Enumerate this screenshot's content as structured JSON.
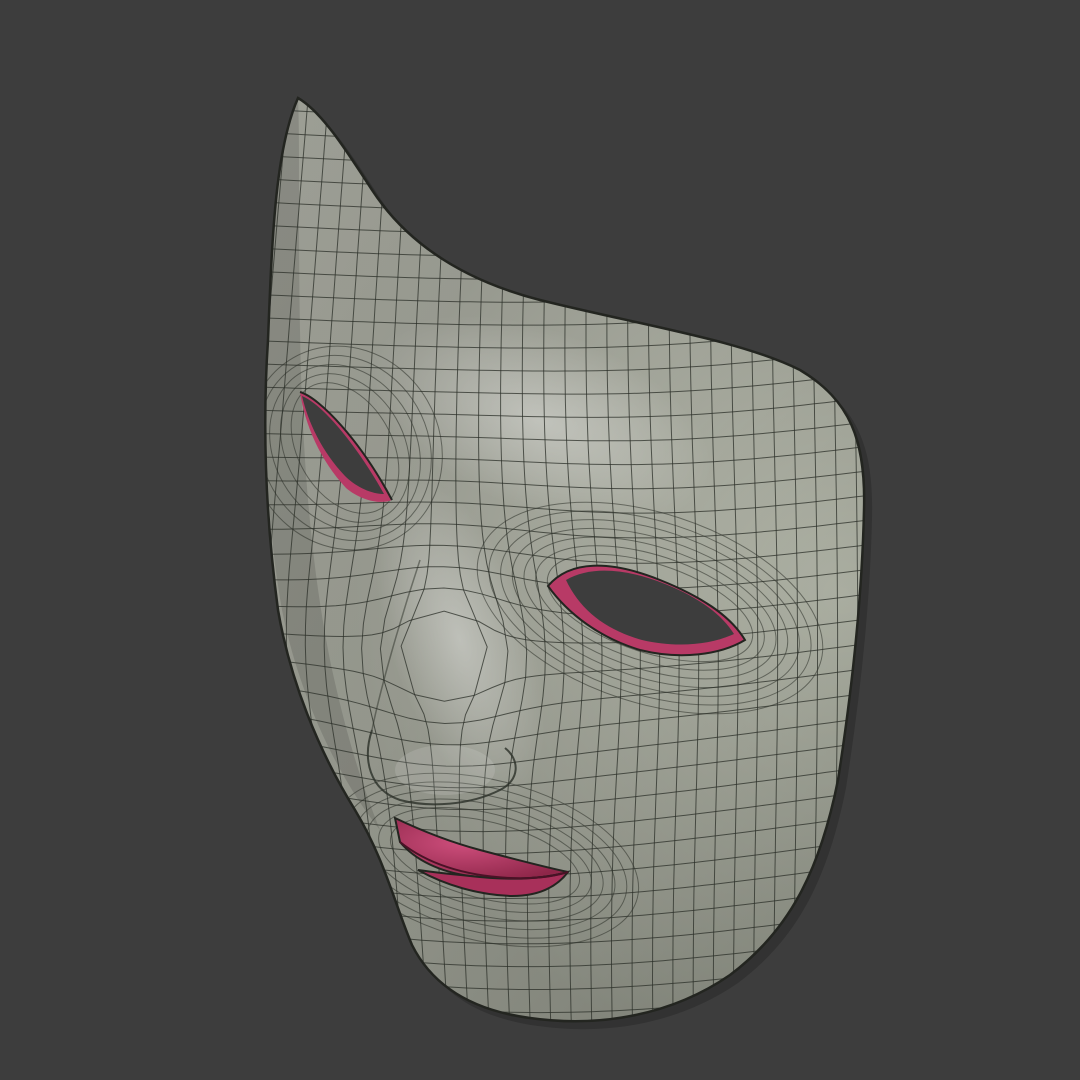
{
  "scene": {
    "subject": "mask-3d-wireframe",
    "colors": {
      "background": "#3d3d3d",
      "mask_surface": "#b9bcaf",
      "mask_highlight": "#d2d4c9",
      "mask_shadow": "#878b7e",
      "wire_lines": "#2b2f28",
      "inner_lining": "#b83a66",
      "inner_lining_dark": "#6e1f3c",
      "outline": "#232520"
    }
  }
}
